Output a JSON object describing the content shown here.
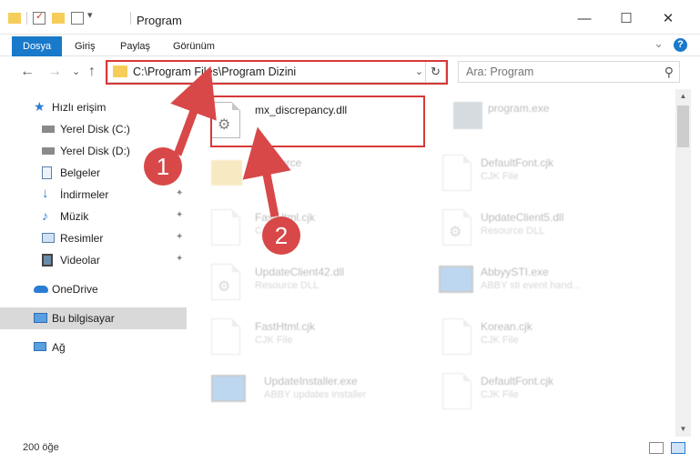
{
  "window": {
    "title": "Program",
    "minimize": "—",
    "maximize": "☐",
    "close": "✕"
  },
  "ribbon": {
    "tabs": [
      "Dosya",
      "Giriş",
      "Paylaş",
      "Görünüm"
    ],
    "help": "?",
    "collapse": "⌄",
    "accent": "#1979ca"
  },
  "nav": {
    "back": "←",
    "forward": "→",
    "recent": "⌄",
    "up": "↑",
    "address": "C:\\Program Files\\Program Dizini",
    "address_dropdown": "⌄",
    "refresh": "↻",
    "search_placeholder": "Ara: Program",
    "search_icon": "⚲"
  },
  "sidebar": {
    "items": [
      {
        "label": "Hızlı erişim",
        "icon": "star-icon",
        "pinned": false
      },
      {
        "label": "Yerel Disk (C:)",
        "icon": "drive-icon",
        "pinned": false
      },
      {
        "label": "Yerel Disk (D:)",
        "icon": "drive-icon",
        "pinned": true
      },
      {
        "label": "Belgeler",
        "icon": "documents-icon",
        "pinned": true
      },
      {
        "label": "İndirmeler",
        "icon": "download-icon",
        "pinned": true
      },
      {
        "label": "Müzik",
        "icon": "music-icon",
        "pinned": true
      },
      {
        "label": "Resimler",
        "icon": "pictures-icon",
        "pinned": true
      },
      {
        "label": "Videolar",
        "icon": "video-icon",
        "pinned": true
      },
      {
        "label": "OneDrive",
        "icon": "cloud-icon",
        "pinned": false
      },
      {
        "label": "Bu bilgisayar",
        "icon": "computer-icon",
        "pinned": false
      },
      {
        "label": "Ağ",
        "icon": "network-icon",
        "pinned": false
      }
    ],
    "pin_glyph": "📌"
  },
  "files": [
    {
      "name": "mx_discrepancy.dll",
      "type": "",
      "icon": "dll-icon"
    },
    {
      "name": "program.exe",
      "type": "",
      "icon": "exe-icon"
    },
    {
      "name": "Resource",
      "type": "",
      "icon": "folder-icon"
    },
    {
      "name": "DefaultFont.cjk",
      "type": "CJK File",
      "icon": "file-icon"
    },
    {
      "name": "FastHtml.cjk",
      "type": "CJK File",
      "icon": "file-icon"
    },
    {
      "name": "UpdateClient5.dll",
      "type": "Resource DLL",
      "icon": "dll-icon"
    },
    {
      "name": "UpdateClient42.dll",
      "type": "Resource DLL",
      "icon": "dll-icon"
    },
    {
      "name": "AbbyySTI.exe",
      "type": "ABBY sti event hand...",
      "icon": "exe-icon"
    },
    {
      "name": "FastHtml.cjk",
      "type": "CJK File",
      "icon": "file-icon"
    },
    {
      "name": "Korean.cjk",
      "type": "CJK File",
      "icon": "file-icon"
    },
    {
      "name": "UpdateInstaller.exe",
      "type": "ABBY updates installer",
      "icon": "exe-icon"
    },
    {
      "name": "DefaultFont.cjk",
      "type": "CJK File",
      "icon": "file-icon"
    }
  ],
  "status": {
    "count": "200 öğe"
  },
  "annotations": {
    "badge1": "1",
    "badge2": "2",
    "color": "#d83838"
  },
  "scroll": {
    "up": "▲",
    "down": "▼"
  }
}
